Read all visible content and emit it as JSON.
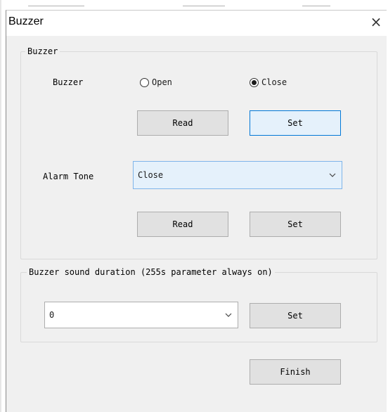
{
  "dialog": {
    "title": "Buzzer",
    "close_glyph": "×"
  },
  "buzzer_group": {
    "legend": "Buzzer",
    "buzzer_label": "Buzzer",
    "radio_open": {
      "label": "Open",
      "checked": false
    },
    "radio_close": {
      "label": "Close",
      "checked": true
    },
    "read_button": "Read",
    "set_button": "Set",
    "alarm_tone_label": "Alarm Tone",
    "alarm_tone_value": "Close",
    "read_button_2": "Read",
    "set_button_2": "Set"
  },
  "duration_group": {
    "legend": "Buzzer sound duration (255s parameter always on)",
    "value": "0",
    "set_button": "Set"
  },
  "finish_button": "Finish",
  "icons": {
    "close": "close-icon",
    "dropdown": "chevron-down-icon",
    "radio": "radio-icon"
  },
  "colors": {
    "focus_border": "#0078d7",
    "focus_fill": "#e5f1fb",
    "button_fill": "#e1e1e1"
  }
}
